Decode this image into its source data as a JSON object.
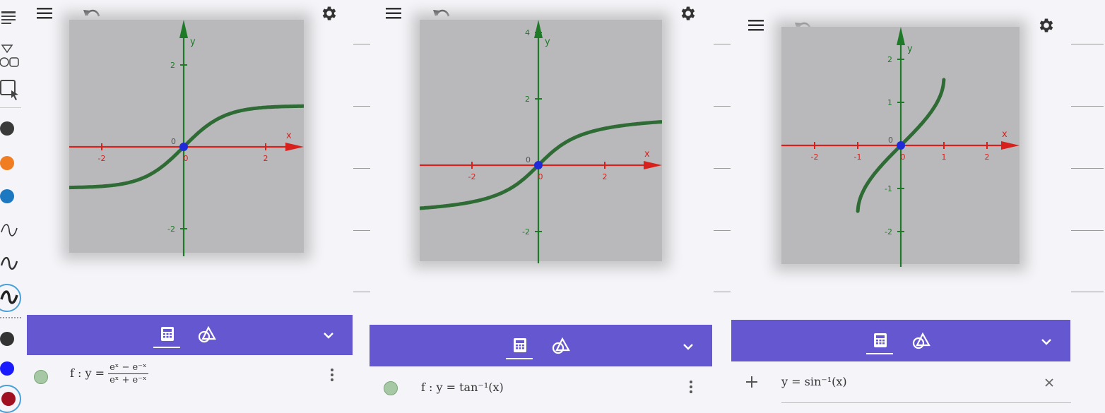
{
  "panels": [
    {
      "id": "tanh",
      "y_ticks": [
        "2",
        "-2"
      ],
      "x_ticks": [
        "-2",
        "0",
        "2"
      ],
      "origin_label": "0",
      "x_axis_label": "x",
      "y_axis_label": "y",
      "expression": {
        "lhs": "f : y =",
        "num": "eˣ − e⁻ˣ",
        "den": "eˣ + e⁻ˣ"
      }
    },
    {
      "id": "arctan",
      "y_ticks": [
        "4",
        "2",
        "-2"
      ],
      "x_ticks": [
        "-2",
        "0",
        "2"
      ],
      "origin_label": "0",
      "x_axis_label": "x",
      "y_axis_label": "y",
      "expression": {
        "text": "f : y = tan⁻¹(x)"
      }
    },
    {
      "id": "arcsin",
      "y_ticks": [
        "2",
        "1",
        "-1",
        "-2"
      ],
      "x_ticks": [
        "-2",
        "-1",
        "0",
        "1",
        "2"
      ],
      "origin_label": "0",
      "x_axis_label": "x",
      "y_axis_label": "y",
      "expression": {
        "text": "y = sin⁻¹(x)"
      }
    }
  ],
  "icons": {
    "menu": "menu-icon",
    "undo": "undo-icon",
    "settings": "gear-icon",
    "calculator": "calculator-icon",
    "geometry": "geometry-tools-icon",
    "collapse": "chevron-down-icon",
    "add": "plus-icon",
    "clear": "close-icon",
    "more": "more-options-icon"
  },
  "sidebar_colors": [
    "#3a3a3a",
    "#f07d22",
    "#1c78c0",
    "#333333",
    "#1a1aff",
    "#a01020"
  ],
  "accent": "#6557d0",
  "curve_color": "#2f6b34",
  "axis_color_x": "#d8201c",
  "axis_color_y": "#1f7a28"
}
